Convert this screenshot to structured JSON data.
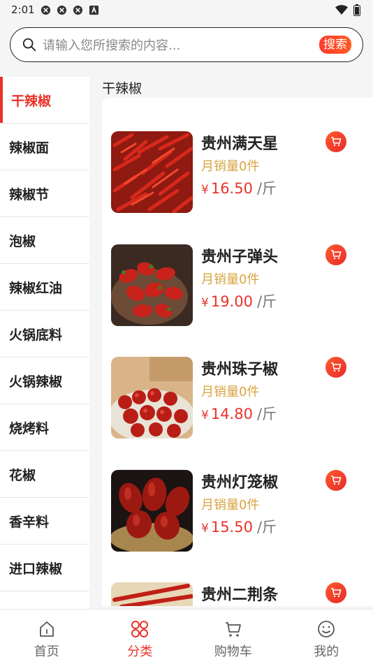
{
  "status_bar": {
    "time": "2:01"
  },
  "search": {
    "placeholder": "请输入您所搜索的内容...",
    "button_label": "搜索"
  },
  "sidebar": {
    "items": [
      {
        "label": "干辣椒",
        "active": true
      },
      {
        "label": "辣椒面"
      },
      {
        "label": "辣椒节"
      },
      {
        "label": "泡椒"
      },
      {
        "label": "辣椒红油"
      },
      {
        "label": "火锅底料"
      },
      {
        "label": "火锅辣椒"
      },
      {
        "label": "烧烤料"
      },
      {
        "label": "花椒"
      },
      {
        "label": "香辛料"
      },
      {
        "label": "进口辣椒"
      }
    ]
  },
  "section": {
    "title": "干辣椒"
  },
  "products": [
    {
      "name": "贵州满天星",
      "sales": "月销量0件",
      "currency": "¥",
      "price": "16.50",
      "unit": "/斤"
    },
    {
      "name": "贵州子弹头",
      "sales": "月销量0件",
      "currency": "¥",
      "price": "19.00",
      "unit": "/斤"
    },
    {
      "name": "贵州珠子椒",
      "sales": "月销量0件",
      "currency": "¥",
      "price": "14.80",
      "unit": "/斤"
    },
    {
      "name": "贵州灯笼椒",
      "sales": "月销量0件",
      "currency": "¥",
      "price": "15.50",
      "unit": "/斤"
    },
    {
      "name": "贵州二荆条"
    }
  ],
  "tabbar": {
    "tabs": [
      {
        "label": "首页",
        "icon": "home-icon"
      },
      {
        "label": "分类",
        "icon": "category-icon",
        "active": true
      },
      {
        "label": "购物车",
        "icon": "cart-icon"
      },
      {
        "label": "我的",
        "icon": "profile-icon"
      }
    ]
  },
  "colors": {
    "accent": "#e8332a",
    "sales": "#d9a441",
    "background": "#f5f5f5"
  }
}
